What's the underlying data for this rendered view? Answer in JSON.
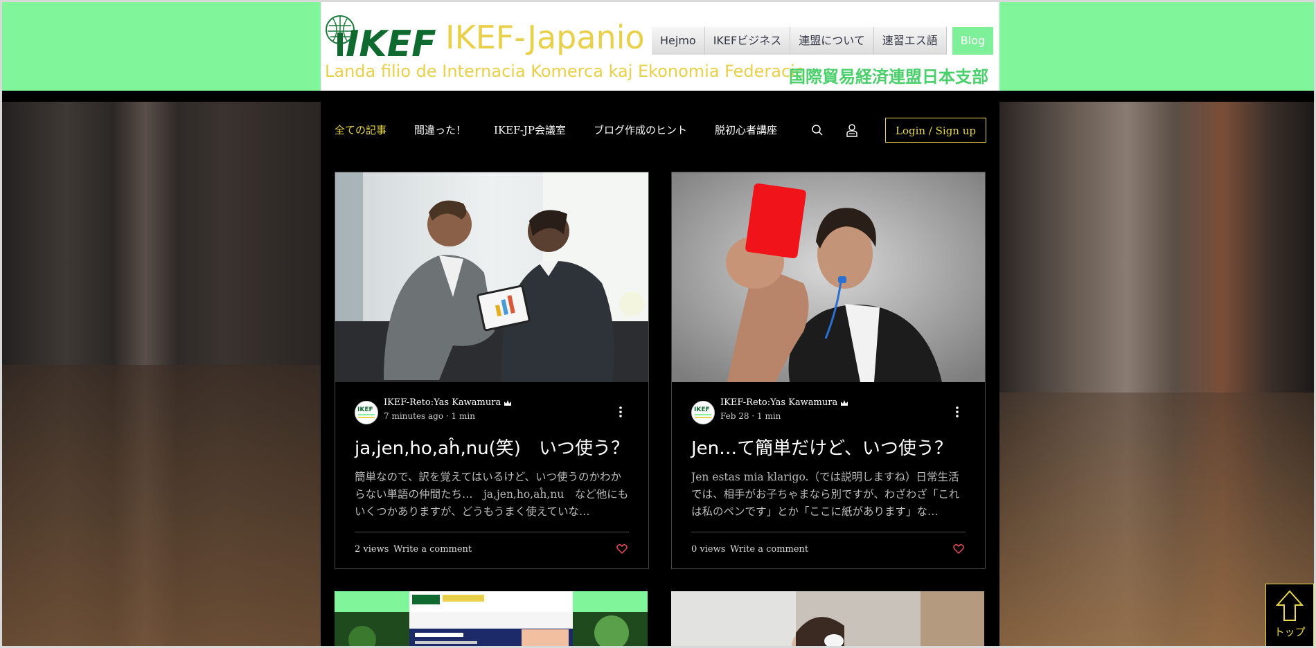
{
  "header": {
    "site_name": "IKEF-Japanio",
    "logo_text": "IKEF",
    "tagline_eo": "Landa filio de Internacia Komerca kaj Ekonomia Federacio",
    "tagline_jp": "国際貿易経済連盟日本支部",
    "nav": [
      "Hejmo",
      "IKEFビジネス",
      "連盟について",
      "速習エス語",
      "Blog"
    ]
  },
  "blog_nav": {
    "categories": [
      "全ての記事",
      "間違った！",
      "IKEF-JP会議室",
      "ブログ作成のヒント",
      "脱初心者講座"
    ],
    "login_label": "Login / Sign up"
  },
  "posts": [
    {
      "author": "IKEF-Reto:Yas Kawamura",
      "time": "7 minutes ago",
      "read": "1 min",
      "title": "ja,jen,ho,aĥ,nu(笑)　いつ使う？",
      "excerpt": "簡単なので、訳を覚えてはいるけど、いつ使うのかわからない単語の仲間たち…　ja,jen,ho,aĥ,nu　など他にもいくつかありますが、どうもうまく使えていな…",
      "views": "2 views",
      "comment_label": "Write a comment"
    },
    {
      "author": "IKEF-Reto:Yas Kawamura",
      "time": "Feb 28",
      "read": "1 min",
      "title": "Jen…て簡単だけど、いつ使う？",
      "excerpt": "Jen estas mia klarigo.（では説明しますね）日常生活では、相手がお子ちゃまなら別ですが、わざわざ「これは私のペンです」とか「ここに紙があります」な…",
      "views": "0 views",
      "comment_label": "Write a comment"
    }
  ],
  "scroll_top_label": "トップ",
  "colors": {
    "header_green": "#80f59a",
    "accent_yellow": "#e8d84a",
    "like_red": "#e84a5a"
  }
}
